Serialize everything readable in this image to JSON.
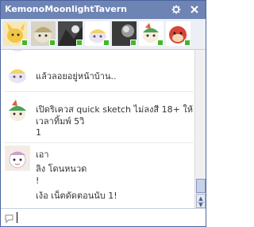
{
  "window": {
    "title": "KemonoMoonlightTavern",
    "settings_icon": "gear-icon",
    "close_icon": "close-icon"
  },
  "participants": [
    {
      "name": "participant-1"
    },
    {
      "name": "participant-2"
    },
    {
      "name": "participant-3"
    },
    {
      "name": "participant-4"
    },
    {
      "name": "participant-5"
    },
    {
      "name": "participant-6"
    },
    {
      "name": "participant-7"
    }
  ],
  "messages": [
    {
      "lines": [
        "แล้วลอยอยู่หน้าบ้าน.."
      ]
    },
    {
      "lines": [
        "เปิดริเควส quick sketch ไม่ลงสี 18+ ให้",
        "เวลาทิ้มพ์ 5วิ",
        "1"
      ]
    },
    {
      "lines": [
        "เอา",
        "ลิง โดนหนวด",
        "!",
        "เง้อ เน็ตดัดตอนนับ 1!"
      ]
    }
  ],
  "input": {
    "value": "",
    "placeholder": ""
  },
  "colors": {
    "titlebar": "#6d84b4",
    "avatar_strip": "#eceff5",
    "online_status": "#42b72a"
  }
}
